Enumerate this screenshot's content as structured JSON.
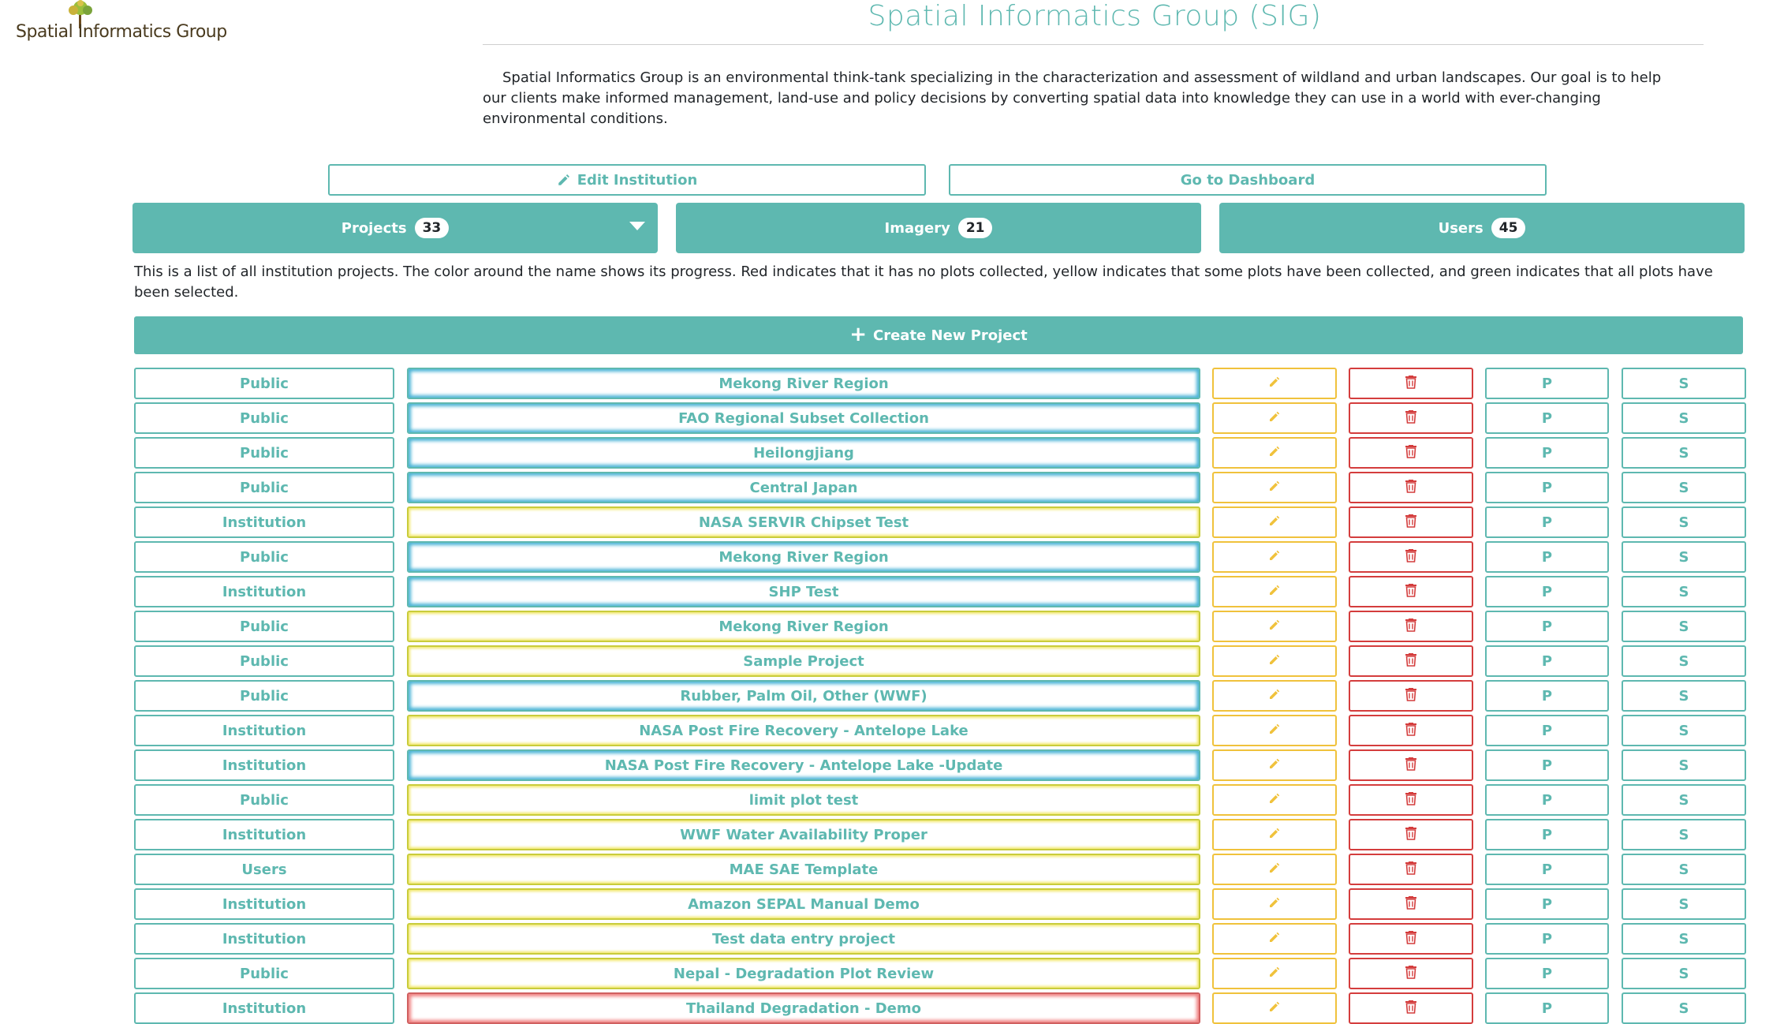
{
  "header": {
    "logo_text": "Spatial Informatics Group",
    "site_title": "Spatial Informatics Group (SIG)",
    "description": "Spatial Informatics Group is an environmental think-tank specializing in the characterization and assessment of wildland and urban landscapes. Our goal is to help our clients make informed management, land-use and policy decisions by converting spatial data into knowledge they can use in a world with ever-changing environmental conditions."
  },
  "actions": {
    "edit_label": "Edit Institution",
    "dashboard_label": "Go to Dashboard"
  },
  "tabs": [
    {
      "label": "Projects",
      "count": "33"
    },
    {
      "label": "Imagery",
      "count": "21"
    },
    {
      "label": "Users",
      "count": "45"
    }
  ],
  "projects_tab": {
    "description": "This is a list of all institution projects. The color around the name shows its progress. Red indicates that it has no plots collected, yellow indicates that some plots have been collected, and green indicates that all plots have been selected.",
    "create_label": "Create New Project",
    "p_label": "P",
    "s_label": "S"
  },
  "colors": {
    "accent": "#5eb8b0",
    "edit": "#f0c23c",
    "delete": "#d43d3d",
    "progress_blue": "#4ab4d6",
    "progress_yellow": "#f1e86a",
    "progress_red": "#f08080"
  },
  "icons": {
    "edit": "pencil-icon",
    "delete": "trash-icon",
    "add": "plus-icon",
    "dropdown": "caret-down-icon"
  },
  "projects": [
    {
      "visibility": "Public",
      "name": "Mekong River Region",
      "status": "blue"
    },
    {
      "visibility": "Public",
      "name": "FAO Regional Subset Collection",
      "status": "blue"
    },
    {
      "visibility": "Public",
      "name": "Heilongjiang",
      "status": "blue"
    },
    {
      "visibility": "Public",
      "name": "Central Japan",
      "status": "blue"
    },
    {
      "visibility": "Institution",
      "name": "NASA SERVIR Chipset Test",
      "status": "yellow"
    },
    {
      "visibility": "Public",
      "name": "Mekong River Region",
      "status": "blue"
    },
    {
      "visibility": "Institution",
      "name": "SHP Test",
      "status": "blue"
    },
    {
      "visibility": "Public",
      "name": "Mekong River Region",
      "status": "yellow"
    },
    {
      "visibility": "Public",
      "name": "Sample Project",
      "status": "yellow"
    },
    {
      "visibility": "Public",
      "name": "Rubber, Palm Oil, Other (WWF)",
      "status": "blue"
    },
    {
      "visibility": "Institution",
      "name": "NASA Post Fire Recovery - Antelope Lake",
      "status": "yellow"
    },
    {
      "visibility": "Institution",
      "name": "NASA Post Fire Recovery - Antelope Lake -Update",
      "status": "blue"
    },
    {
      "visibility": "Public",
      "name": "limit plot test",
      "status": "yellow"
    },
    {
      "visibility": "Institution",
      "name": "WWF Water Availability Proper",
      "status": "yellow"
    },
    {
      "visibility": "Users",
      "name": "MAE SAE Template",
      "status": "yellow"
    },
    {
      "visibility": "Institution",
      "name": "Amazon SEPAL Manual Demo",
      "status": "yellow"
    },
    {
      "visibility": "Institution",
      "name": "Test data entry project",
      "status": "yellow"
    },
    {
      "visibility": "Public",
      "name": "Nepal - Degradation Plot Review",
      "status": "yellow"
    },
    {
      "visibility": "Institution",
      "name": "Thailand Degradation - Demo",
      "status": "red"
    }
  ]
}
